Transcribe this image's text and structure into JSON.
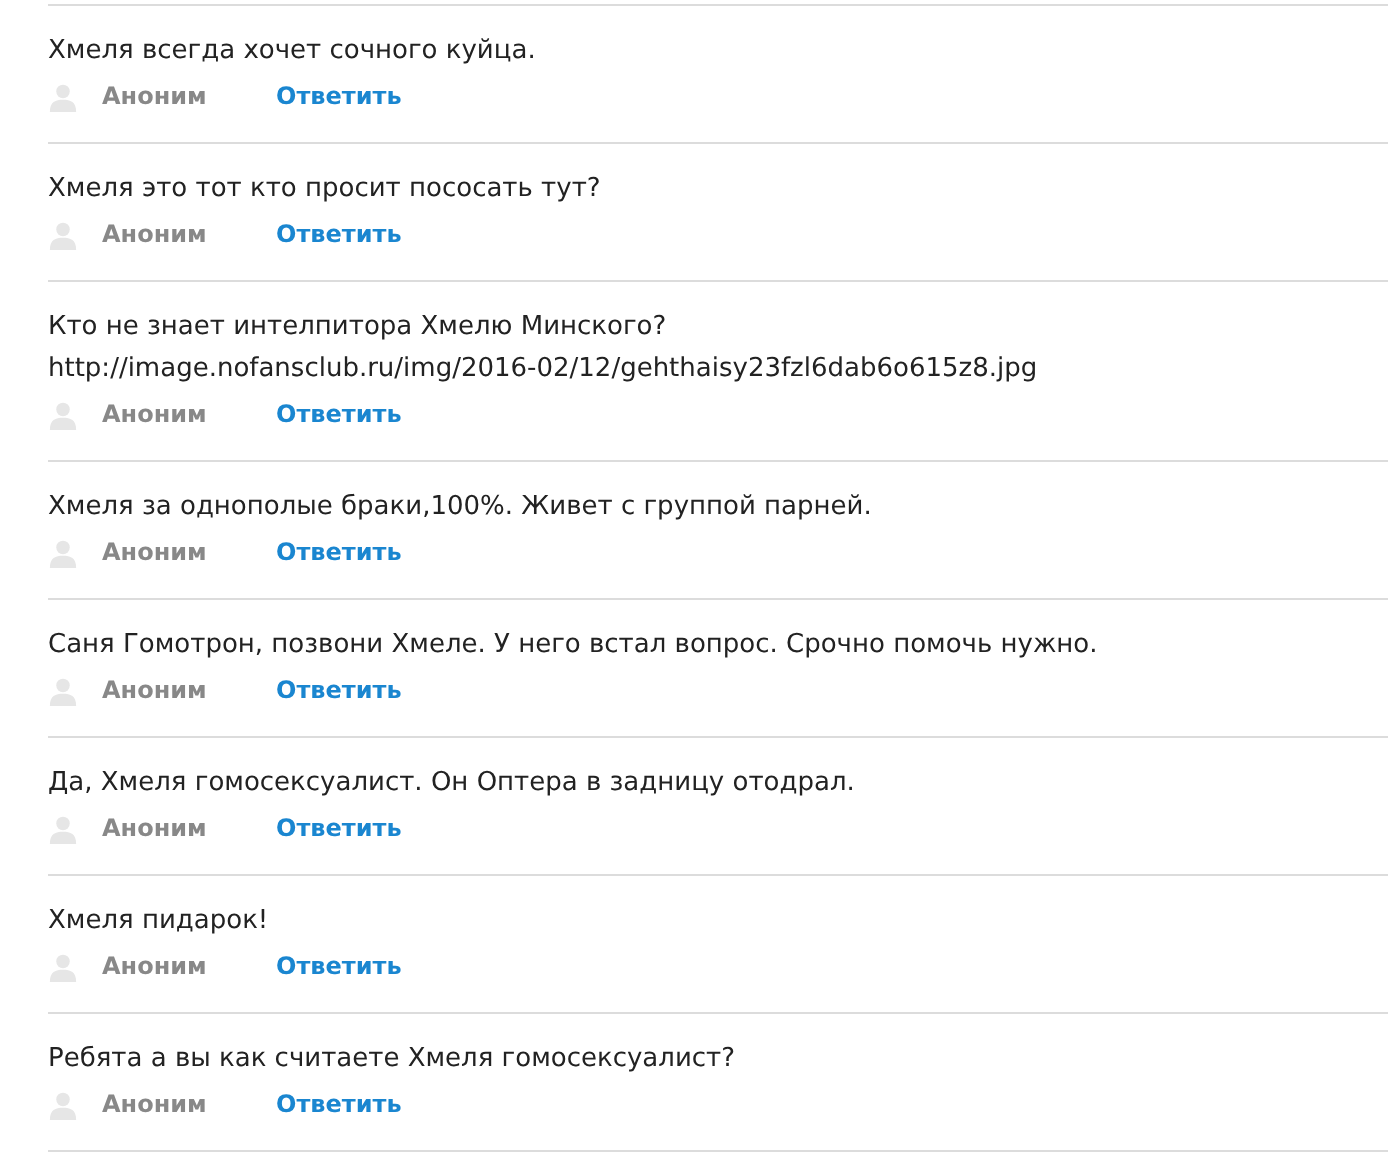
{
  "comments": [
    {
      "lines": [
        "Хмеля всегда хочет сочного куйца."
      ],
      "author": "Аноним",
      "reply": "Ответить"
    },
    {
      "lines": [
        "Хмеля это тот кто просит пососать тут?"
      ],
      "author": "Аноним",
      "reply": "Ответить"
    },
    {
      "lines": [
        "Кто не знает интелпитора Хмелю Минского?",
        "http://image.nofansclub.ru/img/2016-02/12/gehthaisy23fzl6dab6o615z8.jpg"
      ],
      "author": "Аноним",
      "reply": "Ответить"
    },
    {
      "lines": [
        "Хмеля за однополые браки,100%. Живет с группой парней."
      ],
      "author": "Аноним",
      "reply": "Ответить"
    },
    {
      "lines": [
        "Саня Гомотрон, позвони Хмеле. У него встал вопрос. Срочно помочь нужно."
      ],
      "author": "Аноним",
      "reply": "Ответить"
    },
    {
      "lines": [
        "Да, Хмеля гомосексуалист. Он Оптера в задницу отодрал."
      ],
      "author": "Аноним",
      "reply": "Ответить"
    },
    {
      "lines": [
        "Хмеля пидарок!"
      ],
      "author": "Аноним",
      "reply": "Ответить"
    },
    {
      "lines": [
        "Ребята а вы как считаете Хмеля гомосексуалист?"
      ],
      "author": "Аноним",
      "reply": "Ответить"
    }
  ]
}
